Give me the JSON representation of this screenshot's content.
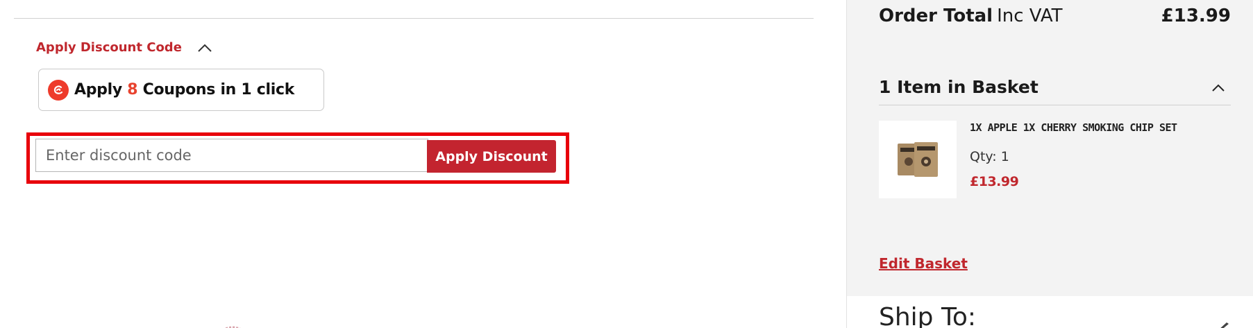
{
  "discount": {
    "toggle_label": "Apply Discount Code",
    "input_placeholder": "Enter discount code",
    "input_value": "",
    "apply_button_label": "Apply Discount"
  },
  "coupon_banner": {
    "prefix": "Apply ",
    "count": "8",
    "suffix": " Coupons in 1 click",
    "logo_color": "#ee3b2b"
  },
  "summary": {
    "order_total_label": "Order Total",
    "order_total_suffix": "Inc VAT",
    "order_total_value": "£13.99",
    "basket_heading": "1 Item in Basket",
    "edit_basket_label": "Edit Basket",
    "ship_to_heading": "Ship To:"
  },
  "basket_items": [
    {
      "name": "1X APPLE 1X CHERRY SMOKING CHIP SET",
      "qty_label": "Qty: 1",
      "price": "£13.99"
    }
  ],
  "colors": {
    "brand_red": "#c0272d",
    "button_red": "#c3242f",
    "highlight_red": "#e8000b",
    "sidebar_bg": "#f3f3f3"
  },
  "icons": {
    "discount_toggle": "chevron-up-icon",
    "basket_toggle": "chevron-up-icon",
    "coupon_logo": "coupon-brand-logo",
    "ship_edit": "pencil-icon"
  }
}
